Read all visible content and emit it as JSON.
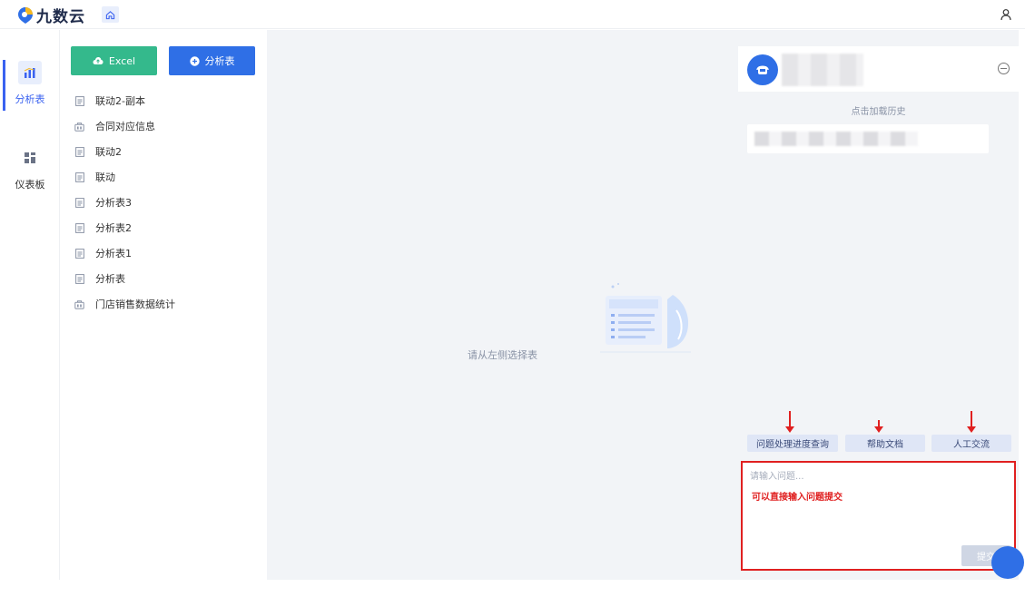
{
  "app": {
    "brand": "九数云"
  },
  "rail": {
    "items": [
      {
        "label": "分析表",
        "active": true
      },
      {
        "label": "仪表板",
        "active": false
      }
    ]
  },
  "toolbar": {
    "excel_label": "Excel",
    "analysis_label": "分析表"
  },
  "tables": [
    {
      "name": "联动2-副本",
      "icon": "sheet-icon"
    },
    {
      "name": "合同对应信息",
      "icon": "bag-icon"
    },
    {
      "name": "联动2",
      "icon": "sheet-icon"
    },
    {
      "name": "联动",
      "icon": "sheet-icon"
    },
    {
      "name": "分析表3",
      "icon": "sheet-icon"
    },
    {
      "name": "分析表2",
      "icon": "sheet-icon"
    },
    {
      "name": "分析表1",
      "icon": "sheet-icon"
    },
    {
      "name": "分析表",
      "icon": "sheet-icon"
    },
    {
      "name": "门店销售数据统计",
      "icon": "bag-icon"
    }
  ],
  "main": {
    "empty_text": "请从左侧选择表"
  },
  "chat": {
    "load_history": "点击加载历史",
    "quick_actions": [
      "问题处理进度查询",
      "帮助文档",
      "人工交流"
    ],
    "input_placeholder": "请输入问题...",
    "annotation": "可以直接输入问题提交",
    "submit_label": "提交"
  },
  "colors": {
    "primary": "#2f6fe6",
    "excel": "#34b98c",
    "annotation": "#e02020"
  }
}
